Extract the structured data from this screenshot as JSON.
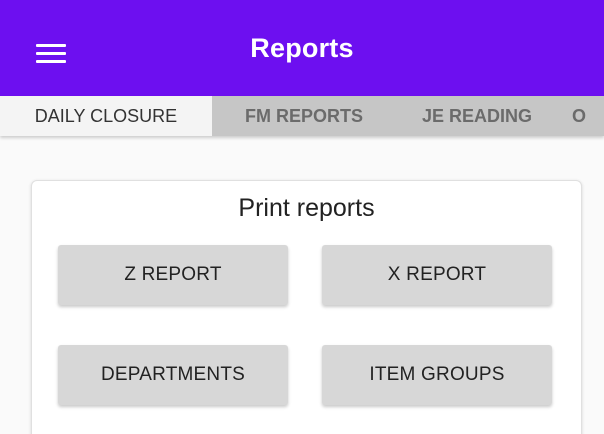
{
  "colors": {
    "appbar": "#6d0ff0",
    "tabbar": "#c6c6c6",
    "button": "#d7d7d7"
  },
  "appbar": {
    "menu_icon": "hamburger-menu-icon",
    "title": "Reports"
  },
  "tabs": [
    {
      "label": "DAILY CLOSURE",
      "active": true
    },
    {
      "label": "FM REPORTS",
      "active": false
    },
    {
      "label": "JE READING",
      "active": false
    },
    {
      "label": "O",
      "active": false
    }
  ],
  "print_card": {
    "title": "Print reports",
    "buttons": {
      "z_report": "Z REPORT",
      "x_report": "X REPORT",
      "departments": "DEPARTMENTS",
      "item_groups": "ITEM GROUPS"
    }
  }
}
